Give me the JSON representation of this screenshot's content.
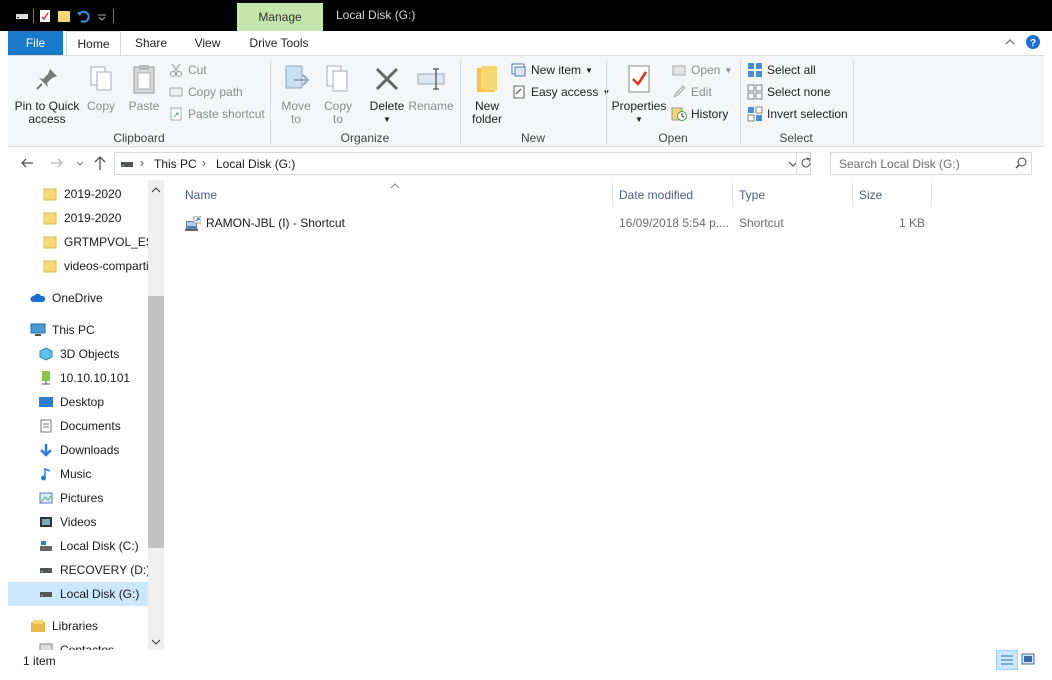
{
  "window": {
    "title": "Local Disk (G:)",
    "manage_tab": "Manage"
  },
  "ribbon_tabs": {
    "file": "File",
    "home": "Home",
    "share": "Share",
    "view": "View",
    "drive_tools": "Drive Tools"
  },
  "clipboard": {
    "pin": "Pin to Quick access",
    "pin_line1": "Pin to Quick",
    "pin_line2": "access",
    "copy": "Copy",
    "paste": "Paste",
    "cut": "Cut",
    "copy_path": "Copy path",
    "paste_shortcut": "Paste shortcut",
    "label": "Clipboard"
  },
  "organize": {
    "move_to": "Move",
    "move_to_2": "to",
    "copy_to": "Copy",
    "copy_to_2": "to",
    "delete": "Delete",
    "rename": "Rename",
    "label": "Organize"
  },
  "new_group": {
    "new_folder_1": "New",
    "new_folder_2": "folder",
    "new_item": "New item",
    "easy_access": "Easy access",
    "label": "New"
  },
  "open_group": {
    "properties": "Properties",
    "open": "Open",
    "edit": "Edit",
    "history": "History",
    "label": "Open"
  },
  "select_group": {
    "select_all": "Select all",
    "select_none": "Select none",
    "invert": "Invert selection",
    "label": "Select"
  },
  "address": {
    "crumbs": [
      "This PC",
      "Local Disk (G:)"
    ],
    "search_placeholder": "Search Local Disk (G:)"
  },
  "nav_pane": {
    "items": [
      {
        "label": "2019-2020",
        "icon": "folder-icon"
      },
      {
        "label": "2019-2020",
        "icon": "folder-icon"
      },
      {
        "label": "GRTMPVOL_ES_I",
        "icon": "folder-icon"
      },
      {
        "label": "videos-comparti",
        "icon": "folder-icon"
      },
      {
        "label": "OneDrive",
        "icon": "onedrive-icon"
      },
      {
        "label": "This PC",
        "icon": "this-pc-icon"
      },
      {
        "label": "3D Objects",
        "icon": "3d-objects-icon"
      },
      {
        "label": "10.10.10.101",
        "icon": "network-drive-icon"
      },
      {
        "label": "Desktop",
        "icon": "desktop-icon"
      },
      {
        "label": "Documents",
        "icon": "documents-icon"
      },
      {
        "label": "Downloads",
        "icon": "downloads-icon"
      },
      {
        "label": "Music",
        "icon": "music-icon"
      },
      {
        "label": "Pictures",
        "icon": "pictures-icon"
      },
      {
        "label": "Videos",
        "icon": "videos-icon"
      },
      {
        "label": "Local Disk (C:)",
        "icon": "local-disk-icon"
      },
      {
        "label": "RECOVERY (D:)",
        "icon": "drive-icon"
      },
      {
        "label": "Local Disk (G:)",
        "icon": "drive-icon"
      },
      {
        "label": "Libraries",
        "icon": "libraries-icon"
      },
      {
        "label": "Contactos",
        "icon": "contacts-icon"
      }
    ]
  },
  "columns": {
    "name": "Name",
    "date": "Date modified",
    "type": "Type",
    "size": "Size"
  },
  "files": [
    {
      "name": "RAMON-JBL (I) - Shortcut",
      "date": "16/09/2018 5:54 p....",
      "type": "Shortcut",
      "size": "1 KB"
    }
  ],
  "status": {
    "count": "1 item"
  },
  "colors": {
    "file_tab": "#1979ca",
    "manage_tab": "#c5e6ab",
    "selected_nav": "#cce8ff",
    "header_text": "#4c607a"
  }
}
